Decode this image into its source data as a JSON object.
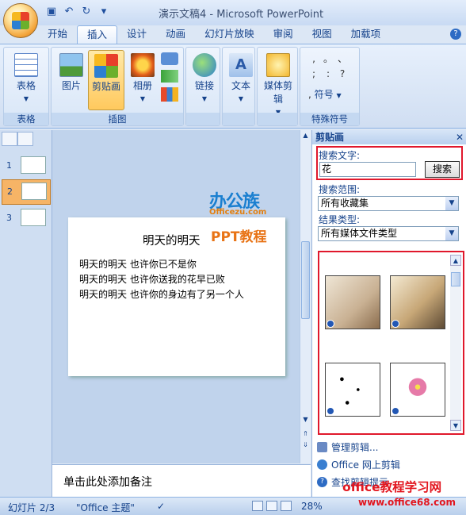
{
  "window": {
    "title": "演示文稿4 - Microsoft PowerPoint"
  },
  "tabs": [
    "开始",
    "插入",
    "设计",
    "动画",
    "幻灯片放映",
    "审阅",
    "视图",
    "加载项"
  ],
  "ribbon": {
    "table_group": {
      "button": "表格",
      "label": "表格"
    },
    "illustrations_group": {
      "picture": "图片",
      "clipart": "剪贴画",
      "album": "相册",
      "label": "插图"
    },
    "links": {
      "button": "链接"
    },
    "text": {
      "button": "文本"
    },
    "media": {
      "button": "媒体剪辑"
    },
    "symbols_group": {
      "symbol": "符号",
      "label": "特殊符号",
      "chars": [
        ",",
        "。",
        "、",
        ";",
        ":",
        "?"
      ]
    }
  },
  "slides": {
    "numbers": [
      "1",
      "2",
      "3"
    ],
    "selected": "2"
  },
  "slide": {
    "title": "明天的明天",
    "lines": [
      "明天的明天  也许你已不是你",
      "明天的明天  也许你送我的花早已败",
      "明天的明天   也许你的身边有了另一个人"
    ]
  },
  "watermarks": {
    "brand": "办公族",
    "brand_url": "Officezu.com",
    "ppt": "PPT教程",
    "site_title": "office教程学习网",
    "site_url": "www.office68.com"
  },
  "notes": {
    "placeholder": "单击此处添加备注"
  },
  "taskpane": {
    "title": "剪贴画",
    "search_label": "搜索文字:",
    "search_value": "花",
    "search_button": "搜索",
    "scope_label": "搜索范围:",
    "scope_value": "所有收藏集",
    "type_label": "结果类型:",
    "type_value": "所有媒体文件类型",
    "links": [
      "管理剪辑...",
      "Office 网上剪辑",
      "查找剪辑提示"
    ]
  },
  "status": {
    "slide": "幻灯片 2/3",
    "theme": "\"Office 主题\"",
    "zoom": "28%"
  }
}
